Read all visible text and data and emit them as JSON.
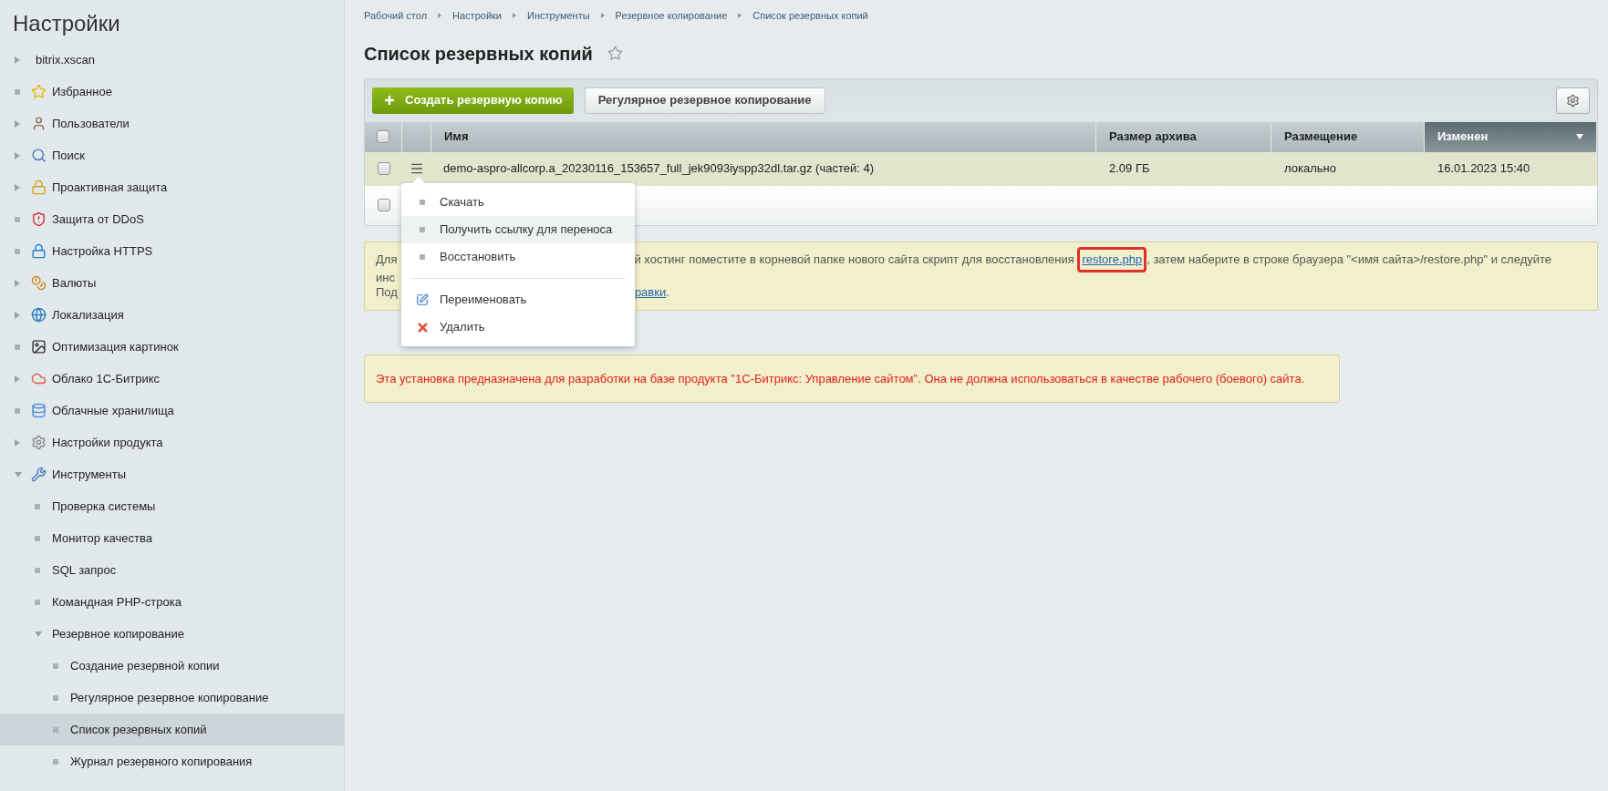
{
  "sidebar": {
    "title": "Настройки",
    "items": [
      {
        "label": "bitrix.xscan",
        "kind": "folder",
        "expanded": false,
        "selected": false
      },
      {
        "label": "Избранное",
        "kind": "page",
        "selected": false
      },
      {
        "label": "Пользователи",
        "kind": "folder",
        "expanded": false,
        "selected": false
      },
      {
        "label": "Поиск",
        "kind": "folder",
        "expanded": false,
        "selected": false
      },
      {
        "label": "Проактивная защита",
        "kind": "folder",
        "expanded": false,
        "selected": false
      },
      {
        "label": "Защита от DDoS",
        "kind": "page",
        "selected": false
      },
      {
        "label": "Настройка HTTPS",
        "kind": "page",
        "selected": false
      },
      {
        "label": "Валюты",
        "kind": "folder",
        "expanded": false,
        "selected": false
      },
      {
        "label": "Локализация",
        "kind": "folder",
        "expanded": false,
        "selected": false
      },
      {
        "label": "Оптимизация картинок",
        "kind": "page",
        "selected": false
      },
      {
        "label": "Облако 1С-Битрикс",
        "kind": "folder",
        "expanded": false,
        "selected": false
      },
      {
        "label": "Облачные хранилища",
        "kind": "page",
        "selected": false
      },
      {
        "label": "Настройки продукта",
        "kind": "folder",
        "expanded": false,
        "selected": false
      },
      {
        "label": "Инструменты",
        "kind": "folder",
        "expanded": true,
        "selected": false,
        "children": [
          {
            "label": "Проверка системы",
            "kind": "page",
            "selected": false
          },
          {
            "label": "Монитор качества",
            "kind": "page",
            "selected": false
          },
          {
            "label": "SQL запрос",
            "kind": "page",
            "selected": false
          },
          {
            "label": "Командная PHP-строка",
            "kind": "page",
            "selected": false
          },
          {
            "label": "Резервное копирование",
            "kind": "folder",
            "expanded": true,
            "selected": false,
            "children": [
              {
                "label": "Создание резервной копии",
                "kind": "page",
                "selected": false
              },
              {
                "label": "Регулярное резервное копирование",
                "kind": "page",
                "selected": false
              },
              {
                "label": "Список резервных копий",
                "kind": "page",
                "selected": true
              },
              {
                "label": "Журнал резервного копирования",
                "kind": "page",
                "selected": false
              }
            ]
          }
        ]
      }
    ]
  },
  "breadcrumbs": [
    "Рабочий стол",
    "Настройки",
    "Инструменты",
    "Резервное копирование",
    "Список резервных копий"
  ],
  "page_title": "Список резервных копий",
  "favorite": false,
  "toolbar": {
    "create_button": "Создать резервную копию",
    "schedule_button": "Регулярное резервное копирование"
  },
  "table": {
    "header_checked": false,
    "columns": [
      {
        "label": "Имя",
        "sorted": false
      },
      {
        "label": "Размер архива",
        "sorted": false
      },
      {
        "label": "Размещение",
        "sorted": false
      },
      {
        "label": "Изменен",
        "sorted": true
      }
    ],
    "rows": [
      {
        "name": "demo-aspro-allcorp.a_20230116_153657_full_jek9093iyspp32dl.tar.gz (частей: 4)",
        "size": "2.09 ГБ",
        "location": "локально",
        "modified": "16.01.2023 15:40",
        "checked": false,
        "selected": true
      }
    ],
    "footer_checked": false
  },
  "context_menu": [
    {
      "label": "Скачать",
      "kind": "bullet",
      "selected": false
    },
    {
      "label": "Получить ссылку для переноса",
      "kind": "bullet",
      "selected": true
    },
    {
      "label": "Восстановить",
      "kind": "bullet",
      "selected": false
    },
    {
      "kind": "separator"
    },
    {
      "label": "Переименовать",
      "kind": "rename",
      "selected": false
    },
    {
      "label": "Удалить",
      "kind": "delete",
      "selected": false
    }
  ],
  "info": {
    "line1_start": "Для",
    "line1_text": "й хостинг поместите в корневой папке нового сайта скрипт для восстановления ",
    "line1_link": "restore.php",
    "line1_end": ", затем наберите в строке браузера \"<имя сайта>/restore.php\" и следуйте",
    "line2_start": "инс",
    "line3_start": "Под",
    "line3_link": "равки",
    "line3_end": ".",
    "highlighted": true
  },
  "warning": "Эта установка предназначена для разработки на базе продукта \"1С-Битрикс: Управление сайтом\". Она не должна использоваться в качестве рабочего (боевого) сайта."
}
